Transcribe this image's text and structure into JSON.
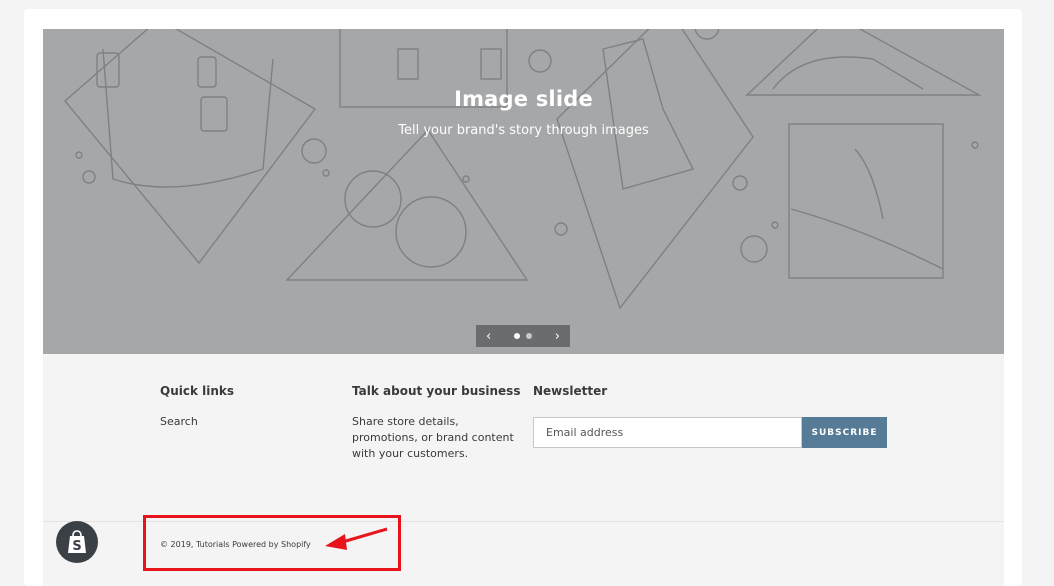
{
  "hero": {
    "title": "Image slide",
    "subtitle": "Tell your brand's story through images",
    "prev_icon": "chevron-left-icon",
    "next_icon": "chevron-right-icon",
    "slide_count": 2,
    "active_slide": 1,
    "background_color": "#a6a7a9"
  },
  "footer": {
    "quick_links": {
      "title": "Quick links",
      "items": [
        {
          "label": "Search"
        }
      ]
    },
    "business": {
      "title": "Talk about your business",
      "lines": [
        "Share store details,",
        "promotions, or brand content",
        "with your customers."
      ]
    },
    "newsletter": {
      "title": "Newsletter",
      "placeholder": "Email address",
      "subscribe_label": "SUBSCRIBE",
      "button_color": "#557b97"
    },
    "copyright_prefix": "© 2019, Tutorials",
    "powered_by": "Powered by Shopify"
  },
  "annotation": {
    "color": "#e8141b"
  },
  "shopify_badge": {
    "icon": "shopify-bag-icon",
    "color": "#3b4047"
  }
}
